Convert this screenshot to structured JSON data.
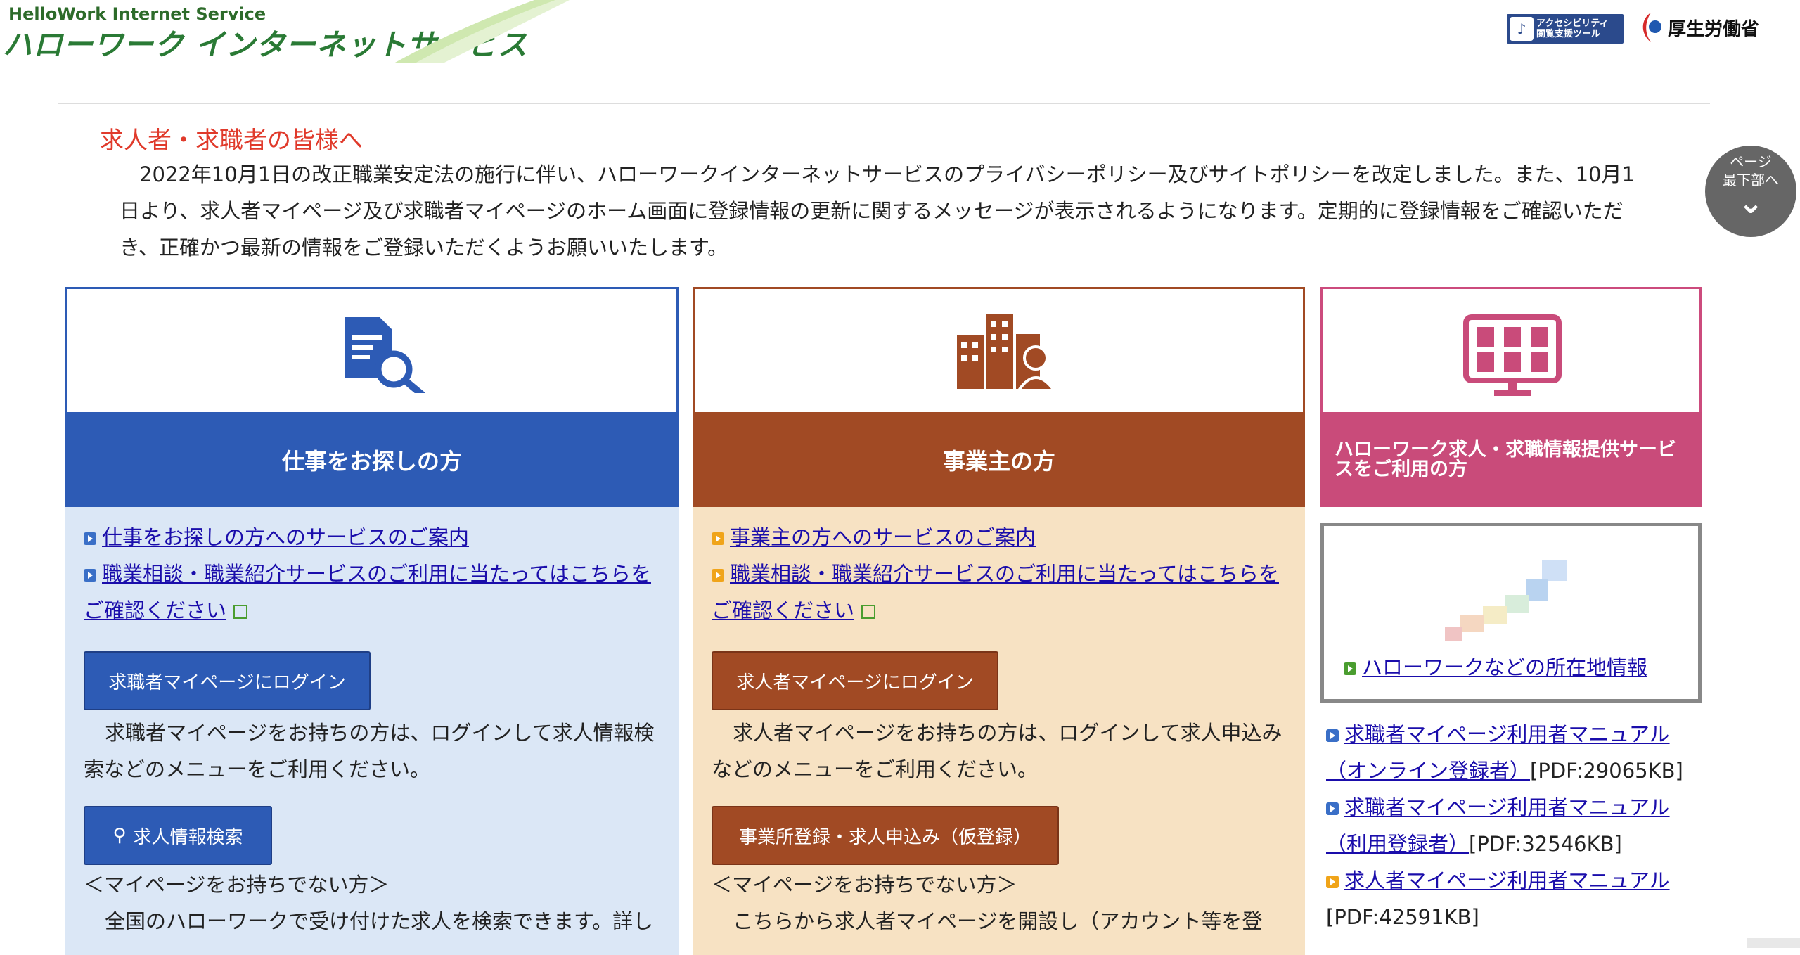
{
  "header": {
    "logo_en": "HelloWork Internet Service",
    "logo_ja": "ハローワーク インターネットサービス",
    "accessibility_tool": {
      "line1": "アクセシビリティ",
      "line2": "閲覧支援ツール"
    },
    "ministry": "厚生労働省"
  },
  "notice": {
    "title": "求人者・求職者の皆様へ",
    "text": "2022年10月1日の改正職業安定法の施行に伴い、ハローワークインターネットサービスのプライバシーポリシー及びサイトポリシーを改定しました。また、10月1日より、求人者マイページ及び求職者マイページのホーム画面に登録情報の更新に関するメッセージが表示されるようになります。定期的に登録情報をご確認いただき、正確かつ最新の情報をご登録いただくようお願いいたします。"
  },
  "page_bottom": {
    "line1": "ページ",
    "line2": "最下部へ"
  },
  "job_seeker": {
    "title": "仕事をお探しの方",
    "link1": "仕事をお探しの方へのサービスのご案内",
    "link2": "職業相談・職業紹介サービスのご利用に当たってはこちらをご確認ください",
    "login_button": "求職者マイページにログイン",
    "login_desc": "求職者マイページをお持ちの方は、ログインして求人情報検索などのメニューをご利用ください。",
    "search_button": "求人情報検索",
    "no_mypage": "＜マイページをお持ちでない方＞",
    "search_desc": "全国のハローワークで受け付けた求人を検索できます。詳し"
  },
  "employer": {
    "title": "事業主の方",
    "link1": "事業主の方へのサービスのご案内",
    "link2": "職業相談・職業紹介サービスのご利用に当たってはこちらをご確認ください",
    "login_button": "求人者マイページにログイン",
    "login_desc": "求人者マイページをお持ちの方は、ログインして求人申込みなどのメニューをご利用ください。",
    "register_button": "事業所登録・求人申込み（仮登録）",
    "no_mypage": "＜マイページをお持ちでない方＞",
    "register_desc": "こちらから求人者マイページを開設し（アカウント等を登"
  },
  "info_service": {
    "title": "ハローワーク求人・求職情報提供サービスをご利用の方",
    "map_link": "ハローワークなどの所在地情報",
    "manuals": [
      {
        "label": "求職者マイページ利用者マニュアル（オンライン登録者）",
        "meta": "[PDF:29065KB]",
        "color": "#3a6fc7"
      },
      {
        "label": "求職者マイページ利用者マニュアル（利用登録者）",
        "meta": "[PDF:32546KB]",
        "color": "#3a6fc7"
      },
      {
        "label": "求人者マイページ利用者マニュアル",
        "meta": "[PDF:42591KB]",
        "color": "#f0a419"
      }
    ]
  },
  "colors": {
    "blue": "#2d5bb5",
    "brown": "#a14a24",
    "pink": "#c94b7a",
    "notice_red": "#e03a2b"
  }
}
